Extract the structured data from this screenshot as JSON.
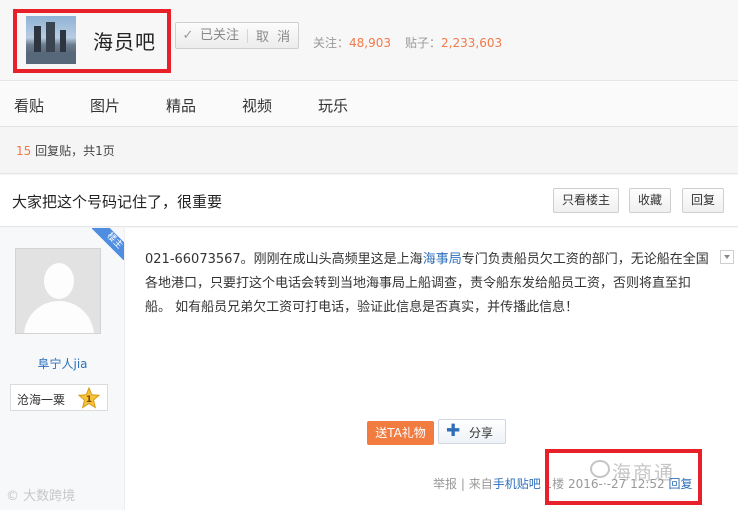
{
  "forum": {
    "name": "海员吧",
    "follow_status": "已关注",
    "cancel_label": "取 消",
    "followers_label": "关注：",
    "followers_count": "48,903",
    "posts_label": "贴子：",
    "posts_count": "2,233,603"
  },
  "nav": {
    "items": [
      "看贴",
      "图片",
      "精品",
      "视频",
      "玩乐"
    ]
  },
  "thread": {
    "reply_count": "15",
    "reply_text": " 回复贴，共",
    "page_count": "1",
    "page_suffix": "页",
    "title": "大家把这个号码记住了，很重要",
    "only_op_label": "只看楼主",
    "favorite_label": "收藏",
    "reply_label": "回复"
  },
  "post": {
    "author_name": "阜宁人jia",
    "op_badge": "楼主",
    "level_badge_name": "沧海一粟",
    "level_number": "1",
    "content_before_link": "021-66073567。刚刚在成山头高频里这是上海",
    "content_link": "海事局",
    "content_after_link": "专门负责船员欠工资的部门，无论船在全国各地港口，只要打这个电话会转到当地海事局上船调查，责令船东发给船员工资，否则将直至扣船。 如有船员兄弟欠工资可打电话，验证此信息是否真实，并传播此信息！",
    "gift_label": "送TA礼物",
    "share_label": "分享",
    "report_label": "举报",
    "source_prefix": "| 来自",
    "source_link": "手机贴吧",
    "floor": "1楼",
    "date": "2016-·-27 12:52",
    "reply_label": "回复"
  },
  "watermarks": {
    "right": "海商通",
    "left": "© 大数跨境"
  },
  "colors": {
    "highlight_red": "#e8202a",
    "count_orange": "#f07a4a",
    "link_blue": "#2f6fba",
    "gift_orange": "#f27b3f"
  }
}
